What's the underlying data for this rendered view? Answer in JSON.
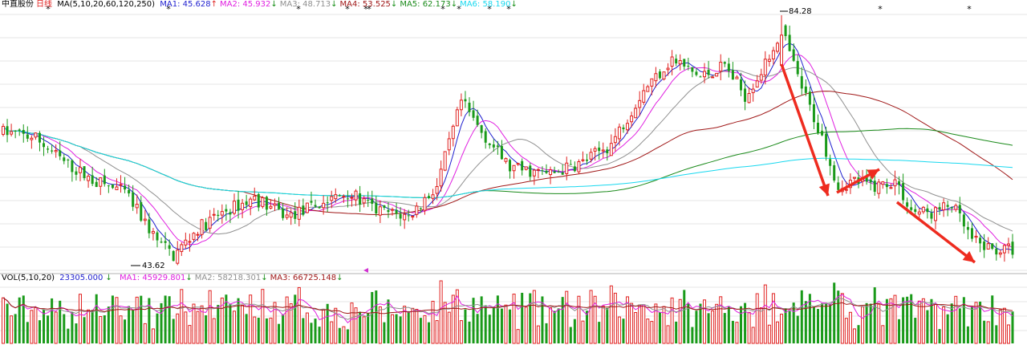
{
  "header": {
    "stock_name": "中直股份",
    "period": "日线",
    "ma_label": "MA(5,10,20,60,120,250)",
    "ma_items": [
      {
        "name": "MA1",
        "value": "45.628",
        "dir": "up",
        "color": "#1f1fcf"
      },
      {
        "name": "MA2",
        "value": "45.932",
        "dir": "down",
        "color": "#e020e0"
      },
      {
        "name": "MA3",
        "value": "48.713",
        "dir": "down",
        "color": "#909090"
      },
      {
        "name": "MA4",
        "value": "53.525",
        "dir": "down",
        "color": "#a01818"
      },
      {
        "name": "MA5",
        "value": "62.173",
        "dir": "down",
        "color": "#1a8a1a"
      },
      {
        "name": "MA6",
        "value": "58.190",
        "dir": "down",
        "color": "#18d8ef"
      }
    ]
  },
  "volume_header": {
    "label": "VOL(5,10,20)",
    "value": "23305.000",
    "dir": "down",
    "ma_items": [
      {
        "name": "MA1",
        "value": "45929.801",
        "dir": "down",
        "color": "#e020e0"
      },
      {
        "name": "MA2",
        "value": "58218.301",
        "dir": "down",
        "color": "#909090"
      },
      {
        "name": "MA3",
        "value": "66725.148",
        "dir": "down",
        "color": "#a01818"
      }
    ]
  },
  "annotations": {
    "high_label": "84.28",
    "low_label": "43.62"
  },
  "colors": {
    "up": "#e0201f",
    "down": "#1a9a1a",
    "grid": "#e6e6e6",
    "arrow": "#ee2b1f"
  },
  "chart_data": {
    "type": "candlestick",
    "title": "中直股份 日线",
    "y_range": [
      42,
      86
    ],
    "high": 84.28,
    "low": 43.62,
    "candles": 250,
    "close_path": [
      {
        "i": 0,
        "c": 65
      },
      {
        "i": 8,
        "c": 64
      },
      {
        "i": 15,
        "c": 60
      },
      {
        "i": 22,
        "c": 57
      },
      {
        "i": 30,
        "c": 55
      },
      {
        "i": 38,
        "c": 47
      },
      {
        "i": 42,
        "c": 44.5
      },
      {
        "i": 48,
        "c": 49
      },
      {
        "i": 55,
        "c": 52
      },
      {
        "i": 62,
        "c": 54
      },
      {
        "i": 70,
        "c": 51
      },
      {
        "i": 78,
        "c": 53
      },
      {
        "i": 85,
        "c": 55
      },
      {
        "i": 92,
        "c": 52
      },
      {
        "i": 100,
        "c": 51
      },
      {
        "i": 107,
        "c": 56
      },
      {
        "i": 113,
        "c": 70
      },
      {
        "i": 118,
        "c": 65
      },
      {
        "i": 125,
        "c": 59
      },
      {
        "i": 135,
        "c": 58
      },
      {
        "i": 143,
        "c": 60
      },
      {
        "i": 150,
        "c": 63
      },
      {
        "i": 158,
        "c": 72
      },
      {
        "i": 165,
        "c": 77
      },
      {
        "i": 172,
        "c": 74
      },
      {
        "i": 178,
        "c": 76
      },
      {
        "i": 183,
        "c": 71
      },
      {
        "i": 188,
        "c": 76
      },
      {
        "i": 192,
        "c": 82
      },
      {
        "i": 196,
        "c": 74
      },
      {
        "i": 202,
        "c": 64
      },
      {
        "i": 206,
        "c": 56
      },
      {
        "i": 210,
        "c": 57
      },
      {
        "i": 215,
        "c": 56
      },
      {
        "i": 220,
        "c": 57
      },
      {
        "i": 224,
        "c": 52
      },
      {
        "i": 229,
        "c": 51.5
      },
      {
        "i": 234,
        "c": 53
      },
      {
        "i": 239,
        "c": 47
      },
      {
        "i": 244,
        "c": 45.5
      },
      {
        "i": 249,
        "c": 45.6
      }
    ],
    "ma_final": {
      "MA5": 45.628,
      "MA10": 45.932,
      "MA20": 48.713,
      "MA60": 53.525,
      "MA120": 62.173,
      "MA250": 58.19
    },
    "volume": {
      "last": 23305.0,
      "ma5": 45929.801,
      "ma10": 58218.301,
      "ma20": 66725.148
    }
  }
}
